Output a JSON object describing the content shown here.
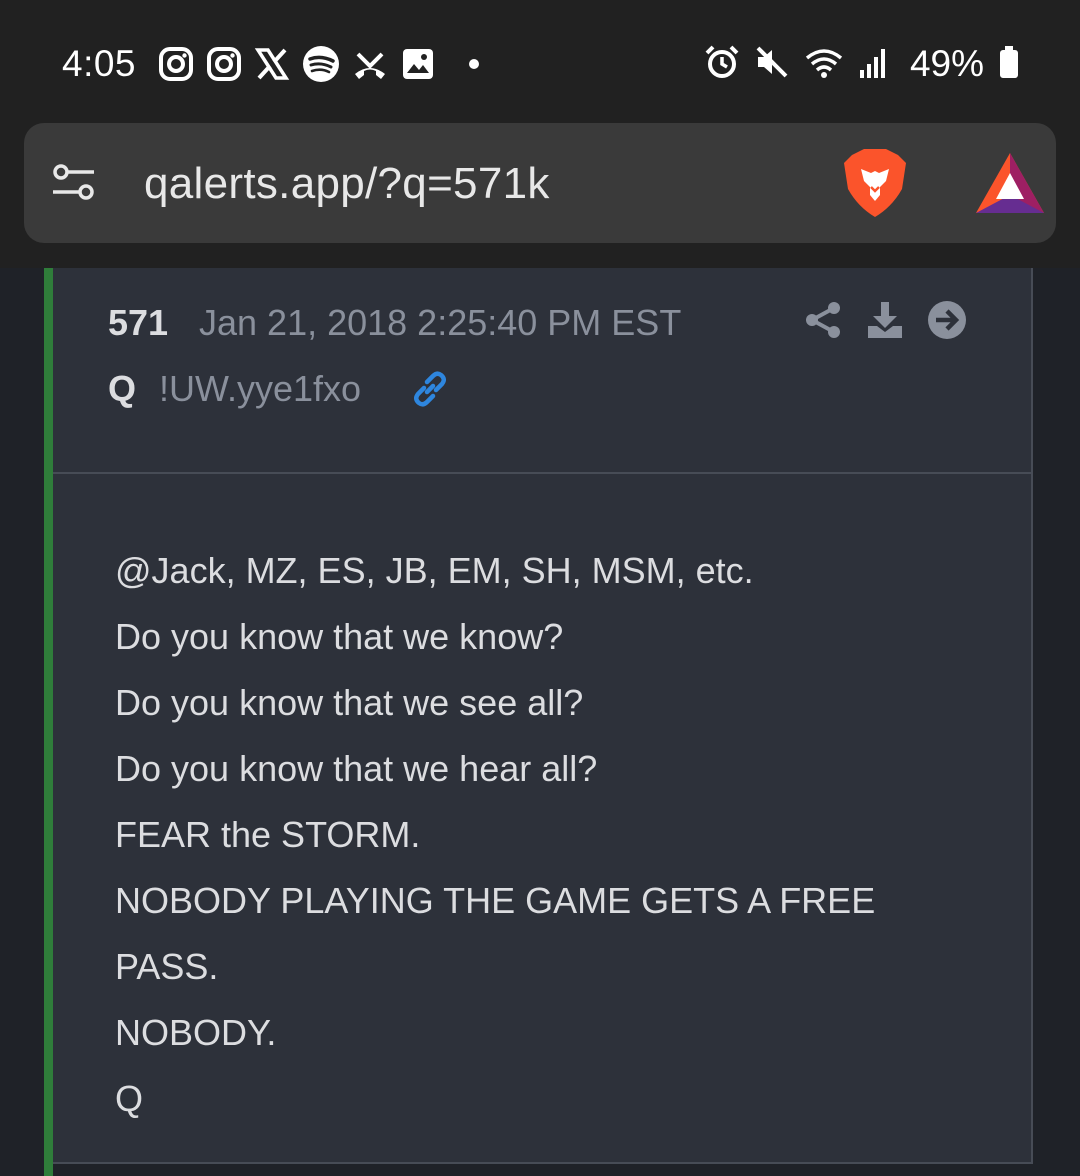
{
  "status_bar": {
    "time": "4:05",
    "notification_icons": [
      "instagram-icon",
      "instagram-icon",
      "x-icon",
      "spotify-icon",
      "missed-call-icon",
      "gallery-icon",
      "more-dot-icon"
    ],
    "system_icons": [
      "alarm-icon",
      "mute-icon",
      "wifi-icon",
      "signal-icon",
      "battery-icon"
    ],
    "battery": "49%"
  },
  "browser": {
    "url": "qalerts.app/?q=571k",
    "brand_colors": {
      "brave": "#fb542b",
      "bat": "#9e1f63"
    }
  },
  "post": {
    "number": "571",
    "date": "Jan 21, 2018 2:25:40 PM EST",
    "author": "Q",
    "tripcode": "!UW.yye1fxo",
    "actions": [
      "share-icon",
      "download-icon",
      "goto-icon"
    ],
    "body_lines": [
      "@Jack, MZ, ES, JB, EM, SH, MSM, etc.",
      "Do you know that we know?",
      "Do you know that we see all?",
      "Do you know that we hear all?",
      "FEAR the STORM.",
      "NOBODY PLAYING THE GAME GETS A FREE",
      "PASS.",
      "NOBODY.",
      "Q"
    ],
    "colors": {
      "accent": "#2f7d3a",
      "card": "#2d313a",
      "link": "#2e86de"
    }
  }
}
